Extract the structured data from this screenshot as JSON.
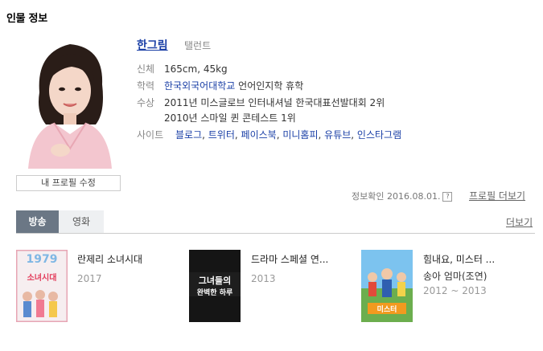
{
  "section_title": "인물 정보",
  "person": {
    "name": "한그림",
    "job": "탤런트",
    "body_label": "신체",
    "body_value": "165cm, 45kg",
    "edu_label": "학력",
    "edu_school": "한국외국어대학교",
    "edu_detail": "언어인지학 휴학",
    "award_label": "수상",
    "awards": [
      "2011년 미스글로브 인터내셔널 한국대표선발대회 2위",
      "2010년 스마일 퀸 콘테스트 1위"
    ],
    "site_label": "사이트",
    "sites": [
      "블로그",
      "트위터",
      "페이스북",
      "미니홈피",
      "유튜브",
      "인스타그램"
    ]
  },
  "edit_button": "내 프로필 수정",
  "info_check": "정보확인 2016.08.01.",
  "help_mark": "?",
  "profile_more": "프로필 더보기",
  "tabs": [
    "방송",
    "영화"
  ],
  "more": "더보기",
  "works": [
    {
      "title": "란제리 소녀시대",
      "role": "",
      "year": "2017",
      "poster_text_top": "1979",
      "poster_text_main": "소녀시대"
    },
    {
      "title": "드라마 스페셜 연...",
      "role": "",
      "year": "2013",
      "poster_text_top": "그녀들의",
      "poster_text_main": "완벽한 하루"
    },
    {
      "title": "힘내요, 미스터 ...",
      "role": "송아 엄마(조연)",
      "year": "2012 ~ 2013",
      "poster_text_top": "",
      "poster_text_main": "미스터"
    }
  ],
  "colors": {
    "link": "#1a3fa6",
    "tab_active_bg": "#6b7785"
  }
}
